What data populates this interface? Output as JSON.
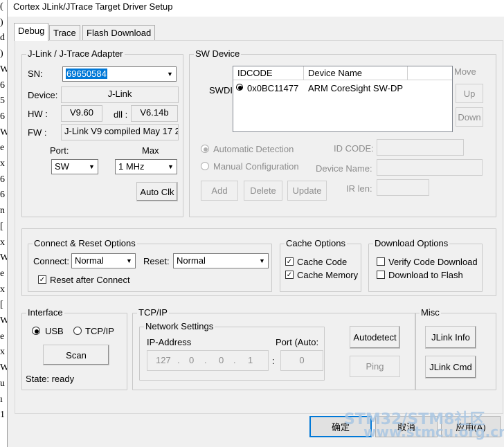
{
  "window": {
    "title": "Cortex JLink/JTrace Target Driver Setup"
  },
  "gutter_chars": [
    "(",
    ")",
    "d",
    ")",
    "W",
    "6",
    "5",
    "6",
    "W",
    "e",
    "x",
    "6",
    "6",
    "n",
    "[",
    "x",
    "W",
    "e",
    "x",
    "[",
    "W",
    "e",
    "x",
    "W",
    "u",
    "ı",
    "1"
  ],
  "tabs": [
    {
      "label": "Debug"
    },
    {
      "label": "Trace"
    },
    {
      "label": "Flash Download"
    }
  ],
  "adapter": {
    "group_label": "J-Link / J-Trace Adapter",
    "sn_label": "SN:",
    "sn_value": "69650584",
    "device_label": "Device:",
    "device_value": "J-Link",
    "hw_label": "HW :",
    "hw_value": "V9.60",
    "dll_label": "dll :",
    "dll_value": "V6.14b",
    "fw_label": "FW :",
    "fw_value": "J-Link V9 compiled May 17 2",
    "port_label": "Port:",
    "port_value": "SW",
    "max_label": "Max",
    "max_value": "1 MHz",
    "autoclk_label": "Auto Clk"
  },
  "swdevice": {
    "group_label": "SW Device",
    "swdi_label": "SWDI",
    "col_idcode": "IDCODE",
    "col_devname": "Device Name",
    "row_idcode": "0x0BC11477",
    "row_devname": "ARM CoreSight SW-DP",
    "move_label": "Move",
    "up_label": "Up",
    "down_label": "Down",
    "auto_detect_label": "Automatic Detection",
    "manual_config_label": "Manual Configuration",
    "idcode_field_label": "ID CODE:",
    "devname_field_label": "Device Name:",
    "irlen_label": "IR len:",
    "add_label": "Add",
    "delete_label": "Delete",
    "update_label": "Update"
  },
  "connect": {
    "group_label": "Connect & Reset Options",
    "connect_label": "Connect:",
    "connect_value": "Normal",
    "reset_label": "Reset:",
    "reset_value": "Normal",
    "reset_after_label": "Reset after Connect",
    "reset_after_checked": true
  },
  "cache": {
    "group_label": "Cache Options",
    "code_label": "Cache Code",
    "code_checked": true,
    "memory_label": "Cache Memory",
    "memory_checked": true
  },
  "download": {
    "group_label": "Download Options",
    "verify_label": "Verify Code Download",
    "verify_checked": false,
    "flash_label": "Download to Flash",
    "flash_checked": false
  },
  "interface": {
    "group_label": "Interface",
    "usb_label": "USB",
    "tcpip_label": "TCP/IP",
    "selected": "USB",
    "scan_label": "Scan",
    "state_text": "State: ready"
  },
  "tcpip": {
    "group_label": "TCP/IP",
    "net_settings_label": "Network Settings",
    "ip_label": "IP-Address",
    "ip_octets": [
      "127",
      "0",
      "0",
      "1"
    ],
    "port_label": "Port (Auto:",
    "port_value": "0",
    "autodetect_label": "Autodetect",
    "ping_label": "Ping"
  },
  "misc": {
    "group_label": "Misc",
    "jlink_info_label": "JLink Info",
    "jlink_cmd_label": "JLink Cmd"
  },
  "footer": {
    "ok_label": "确定",
    "cancel_label": "取消",
    "apply_label": "应用(A)",
    "watermark_title": "STM32/STM8社区",
    "watermark_url": "www.stmcu.org.cn"
  }
}
